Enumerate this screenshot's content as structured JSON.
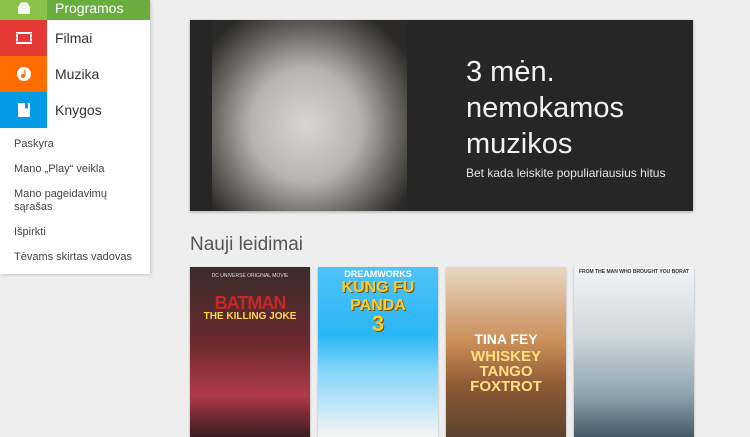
{
  "sidebar": {
    "categories": [
      {
        "label": "Programos",
        "icon": "android-icon",
        "color": "#8bc34a"
      },
      {
        "label": "Filmai",
        "icon": "film-icon",
        "color": "#e53935"
      },
      {
        "label": "Muzika",
        "icon": "music-note-icon",
        "color": "#ff6d00"
      },
      {
        "label": "Knygos",
        "icon": "book-icon",
        "color": "#039be5"
      }
    ],
    "links": [
      "Paskyra",
      "Mano „Play“ veikla",
      "Mano pageidavimų sąrašas",
      "Išpirkti",
      "Tėvams skirtas vadovas"
    ]
  },
  "banner": {
    "headline": "3 mėn. nemokamos muzikos",
    "subtitle": "Bet kada leiskite populiariausius hitus"
  },
  "section": {
    "title": "Nauji leidimai",
    "items": [
      {
        "top": "DC UNIVERSE ORIGINAL MOVIE",
        "title": "BATMAN",
        "subtitle": "THE KILLING JOKE"
      },
      {
        "top": "DREAMWORKS",
        "title": "KUNG FU",
        "subtitle": "PANDA",
        "extra": "3"
      },
      {
        "title": "TINA FEY",
        "subtitle": "WHISKEY TANGO FOXTROT"
      },
      {
        "top": "FROM THE MAN WHO BROUGHT YOU BORAT"
      }
    ]
  }
}
